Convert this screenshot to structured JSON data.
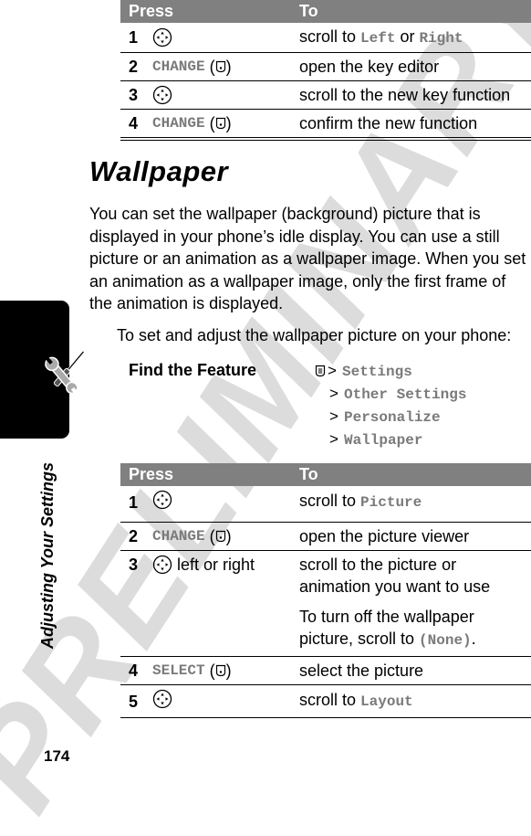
{
  "watermark": "PRELIMINARY",
  "page_number": "174",
  "side_tab": {
    "title": "Adjusting Your Settings",
    "icon": "wrench-screwdriver-icon"
  },
  "table_top": {
    "headers": {
      "press": "Press",
      "to": "To"
    },
    "rows": [
      {
        "num": "1",
        "press_icon": "nav-key-icon",
        "press_text": "",
        "to_parts": [
          "scroll to ",
          {
            "mono": "Left"
          },
          " or ",
          {
            "mono": "Right"
          }
        ]
      },
      {
        "num": "2",
        "press_soft": "CHANGE",
        "press_icon": "center-key-icon",
        "to": "open the key editor"
      },
      {
        "num": "3",
        "press_icon": "nav-key-icon",
        "to": "scroll to the new key function"
      },
      {
        "num": "4",
        "press_soft": "CHANGE",
        "press_icon": "center-key-icon",
        "to": "confirm the new function"
      }
    ]
  },
  "section": {
    "title": "Wallpaper",
    "paragraph": "You can set the wallpaper (background) picture that is displayed in your phone’s idle display. You can use a still picture or an animation as a wallpaper image. When you set an animation as a wallpaper image, only the first frame of the animation is displayed.",
    "intro": "To set and adjust the wallpaper picture on your phone:"
  },
  "find_feature": {
    "label": "Find the Feature",
    "menu_icon": "menu-key-icon",
    "path": [
      "Settings",
      "Other Settings",
      "Personalize",
      "Wallpaper"
    ]
  },
  "table_bottom": {
    "headers": {
      "press": "Press",
      "to": "To"
    },
    "rows": [
      {
        "num": "1",
        "to_prefix": "scroll to ",
        "to_mono": "Picture"
      },
      {
        "num": "2",
        "press_soft": "CHANGE",
        "to": "open the picture viewer"
      },
      {
        "num": "3",
        "press_suffix": "left or right",
        "to": "scroll to the picture or animation you want to use",
        "note_prefix": "To turn off the wallpaper picture, scroll to ",
        "note_mono": "(None)",
        "note_suffix": "."
      },
      {
        "num": "4",
        "press_soft": "SELECT",
        "to": "select the picture"
      },
      {
        "num": "5",
        "to_prefix": "scroll to ",
        "to_mono": "Layout"
      }
    ]
  },
  "top_rows_text": {
    "r1_prefix": "scroll to ",
    "r1_left": "Left",
    "r1_or": " or ",
    "r1_right": "Right"
  }
}
